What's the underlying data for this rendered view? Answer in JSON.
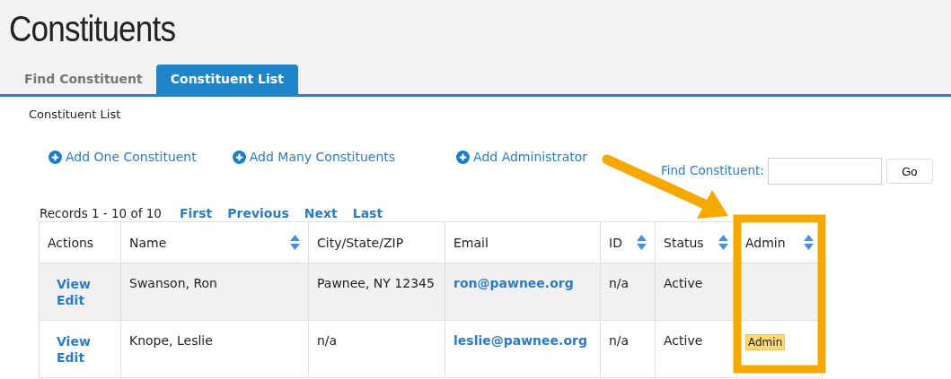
{
  "page_title": "Constituents",
  "tabs": [
    {
      "label": "Find Constituent",
      "selected": false
    },
    {
      "label": "Constituent List",
      "selected": true
    }
  ],
  "breadcrumb": "Constituent List",
  "actions": [
    "Add One Constituent",
    "Add Many Constituents",
    "Add Administrator"
  ],
  "search": {
    "label": "Find Constituent:",
    "button": "Go"
  },
  "pager": {
    "records": "Records 1 - 10 of 10",
    "links": [
      "First",
      "Previous",
      "Next",
      "Last"
    ]
  },
  "table": {
    "columns": [
      {
        "label": "Actions",
        "sortable": false
      },
      {
        "label": "Name",
        "sortable": true
      },
      {
        "label": "City/State/ZIP",
        "sortable": false
      },
      {
        "label": "Email",
        "sortable": false
      },
      {
        "label": "ID",
        "sortable": true
      },
      {
        "label": "Status",
        "sortable": true
      },
      {
        "label": "Admin",
        "sortable": true
      }
    ],
    "rows": [
      {
        "actions": [
          "View",
          "Edit"
        ],
        "name": "Swanson, Ron",
        "city": "Pawnee, NY 12345",
        "email": "ron@pawnee.org",
        "id": "n/a",
        "status": "Active"
      },
      {
        "actions": [
          "View",
          "Edit"
        ],
        "name": "Knope, Leslie",
        "city": "n/a",
        "email": "leslie@pawnee.org",
        "id": "n/a",
        "status": "Active",
        "admin": "Admin"
      }
    ]
  }
}
